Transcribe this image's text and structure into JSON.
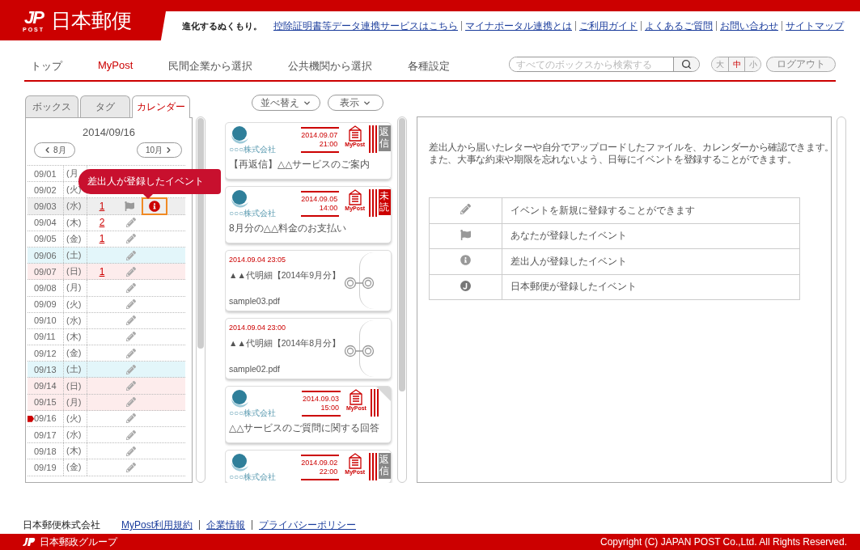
{
  "header": {
    "logo": {
      "mark": "JP",
      "sub": "POST",
      "name": "日本郵便"
    },
    "tagline": "進化するぬくもり。",
    "links": [
      "控除証明書等データ連携サービスはこちら",
      "マイナポータル連携とは",
      "ご利用ガイド",
      "よくあるご質問",
      "お問い合わせ",
      "サイトマップ"
    ]
  },
  "nav": {
    "items": [
      {
        "label": "トップ",
        "selected": false
      },
      {
        "label": "MyPost",
        "selected": true
      },
      {
        "label": "民間企業から選択",
        "selected": false
      },
      {
        "label": "公共機関から選択",
        "selected": false
      },
      {
        "label": "各種設定",
        "selected": false
      }
    ],
    "search": {
      "placeholder": "すべてのボックスから検索する"
    },
    "font_sizes": [
      {
        "label": "大",
        "selected": false
      },
      {
        "label": "中",
        "selected": true
      },
      {
        "label": "小",
        "selected": false
      }
    ],
    "logout": "ログアウト"
  },
  "sidebar": {
    "tabs": [
      {
        "label": "ボックス",
        "selected": false
      },
      {
        "label": "タグ",
        "selected": false
      },
      {
        "label": "カレンダー",
        "selected": true
      }
    ],
    "calendar": {
      "date": "2014/09/16",
      "prev": "8月",
      "next": "10月",
      "tooltip": "差出人が登録したイベント",
      "rows": [
        {
          "date": "09/01",
          "day": "(月",
          "kind": "weekday",
          "selected": false,
          "today": false,
          "events": []
        },
        {
          "date": "09/02",
          "day": "(火)",
          "kind": "weekday",
          "selected": false,
          "today": false,
          "events": []
        },
        {
          "date": "09/03",
          "day": "(水)",
          "kind": "weekday",
          "selected": true,
          "today": false,
          "count": "1",
          "events": [
            {
              "kind": "flag",
              "focused": false
            },
            {
              "kind": "info",
              "focused": true
            }
          ]
        },
        {
          "date": "09/04",
          "day": "(木)",
          "kind": "weekday",
          "selected": false,
          "today": false,
          "count": "2",
          "events": [
            {
              "kind": "pencil",
              "focused": false
            }
          ]
        },
        {
          "date": "09/05",
          "day": "(金)",
          "kind": "weekday",
          "selected": false,
          "today": false,
          "count": "1",
          "events": [
            {
              "kind": "pencil",
              "focused": false
            }
          ]
        },
        {
          "date": "09/06",
          "day": "(土)",
          "kind": "saturday",
          "selected": false,
          "today": false,
          "events": [
            {
              "kind": "pencil",
              "focused": false
            }
          ]
        },
        {
          "date": "09/07",
          "day": "(日)",
          "kind": "holiday",
          "selected": false,
          "today": false,
          "count": "1",
          "events": [
            {
              "kind": "pencil",
              "focused": false
            }
          ]
        },
        {
          "date": "09/08",
          "day": "(月)",
          "kind": "weekday",
          "selected": false,
          "today": false,
          "events": [
            {
              "kind": "pencil",
              "focused": false
            }
          ]
        },
        {
          "date": "09/09",
          "day": "(火)",
          "kind": "weekday",
          "selected": false,
          "today": false,
          "events": [
            {
              "kind": "pencil",
              "focused": false
            }
          ]
        },
        {
          "date": "09/10",
          "day": "(水)",
          "kind": "weekday",
          "selected": false,
          "today": false,
          "events": [
            {
              "kind": "pencil",
              "focused": false
            }
          ]
        },
        {
          "date": "09/11",
          "day": "(木)",
          "kind": "weekday",
          "selected": false,
          "today": false,
          "events": [
            {
              "kind": "pencil",
              "focused": false
            }
          ]
        },
        {
          "date": "09/12",
          "day": "(金)",
          "kind": "weekday",
          "selected": false,
          "today": false,
          "events": [
            {
              "kind": "pencil",
              "focused": false
            }
          ]
        },
        {
          "date": "09/13",
          "day": "(土)",
          "kind": "saturday",
          "selected": false,
          "today": false,
          "events": [
            {
              "kind": "pencil",
              "focused": false
            }
          ]
        },
        {
          "date": "09/14",
          "day": "(日)",
          "kind": "holiday",
          "selected": false,
          "today": false,
          "events": [
            {
              "kind": "pencil",
              "focused": false
            }
          ]
        },
        {
          "date": "09/15",
          "day": "(月)",
          "kind": "holiday",
          "selected": false,
          "today": false,
          "events": [
            {
              "kind": "pencil",
              "focused": false
            }
          ]
        },
        {
          "date": "09/16",
          "day": "(火)",
          "kind": "weekday",
          "selected": false,
          "today": true,
          "events": [
            {
              "kind": "pencil",
              "focused": false
            }
          ]
        },
        {
          "date": "09/17",
          "day": "(水)",
          "kind": "weekday",
          "selected": false,
          "today": false,
          "events": [
            {
              "kind": "pencil",
              "focused": false
            }
          ]
        },
        {
          "date": "09/18",
          "day": "(木)",
          "kind": "weekday",
          "selected": false,
          "today": false,
          "events": [
            {
              "kind": "pencil",
              "focused": false
            }
          ]
        },
        {
          "date": "09/19",
          "day": "(金)",
          "kind": "weekday",
          "selected": false,
          "today": false,
          "events": [
            {
              "kind": "pencil",
              "focused": false
            }
          ]
        }
      ]
    }
  },
  "toolbar": {
    "buttons": [
      "並べ替え",
      "表示"
    ]
  },
  "messages": [
    {
      "kind": "message",
      "sender": "○○○株式会社",
      "date": "2014.09.07",
      "time": "21:00",
      "service": "MyPost",
      "badge": {
        "text": "返信",
        "kind": "replied"
      },
      "folded": false,
      "title": "【再返信】△△サービスのご案内"
    },
    {
      "kind": "message",
      "sender": "○○○株式会社",
      "date": "2014.09.05",
      "time": "14:00",
      "service": "MyPost",
      "badge": {
        "text": "未読",
        "kind": "unread"
      },
      "folded": false,
      "title": "8月分の△△料金のお支払い"
    },
    {
      "kind": "file",
      "date": "2014.09.04 23:05",
      "title": "▲▲代明細【2014年9月分】",
      "file": "sample03.pdf"
    },
    {
      "kind": "file",
      "date": "2014.09.04 23:00",
      "title": "▲▲代明細【2014年8月分】",
      "file": "sample02.pdf"
    },
    {
      "kind": "message",
      "sender": "○○○株式会社",
      "date": "2014.09.03",
      "time": "15:00",
      "service": "MyPost",
      "folded": true,
      "title": "△△サービスのご質問に関する回答"
    },
    {
      "kind": "message",
      "sender": "○○○株式会社",
      "date": "2014.09.02",
      "time": "22:00",
      "service": "MyPost",
      "badge": {
        "text": "返信",
        "kind": "replied"
      },
      "folded": false
    }
  ],
  "info": {
    "description": [
      "差出人から届いたレターや自分でアップロードしたファイルを、カレンダーから確認できます。",
      "また、大事な約束や期限を忘れないよう、日毎にイベントを登録することができます。"
    ],
    "legend": [
      {
        "kind": "pencil",
        "label": "イベントを新規に登録することができます"
      },
      {
        "kind": "flag",
        "label": "あなたが登録したイベント"
      },
      {
        "kind": "info",
        "label": "差出人が登録したイベント"
      },
      {
        "kind": "jp",
        "label": "日本郵便が登録したイベント"
      }
    ]
  },
  "footer": {
    "company": "日本郵便株式会社",
    "links": [
      "MyPost利用規約",
      "企業情報",
      "プライバシーポリシー"
    ],
    "group": "日本郵政グループ",
    "copyright": "Copyright (C) JAPAN POST Co.,Ltd. All Rights Reserved."
  }
}
